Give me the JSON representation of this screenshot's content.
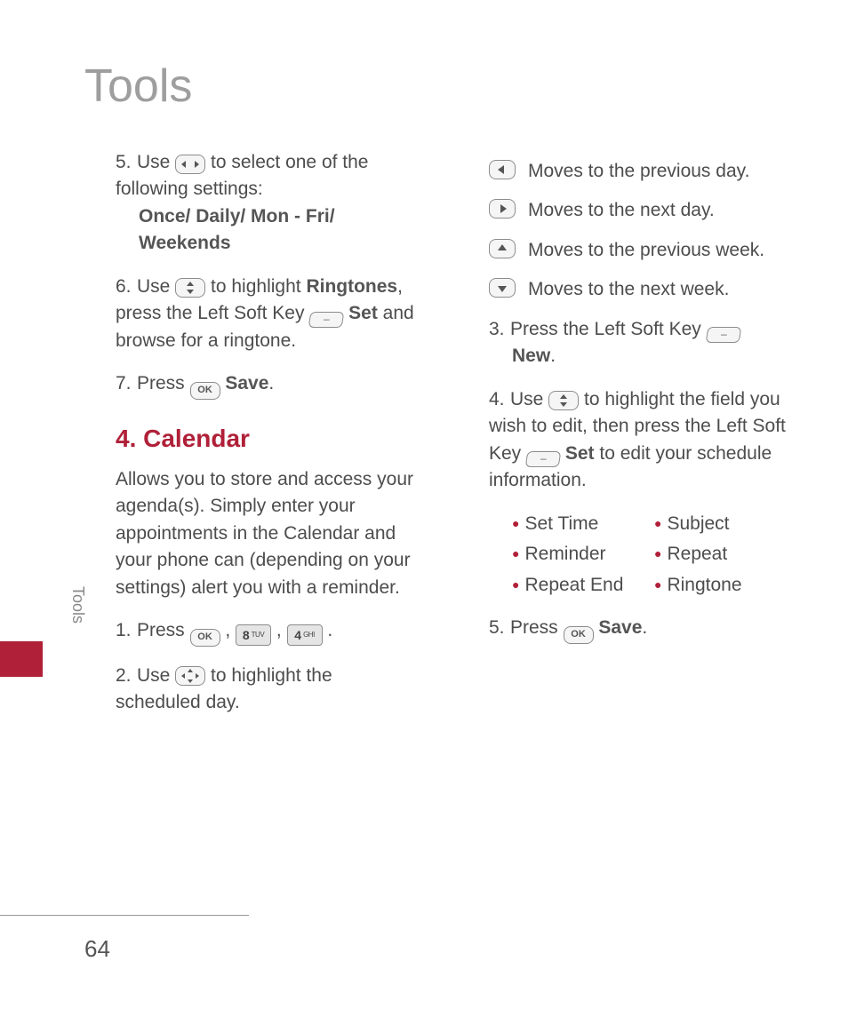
{
  "page_title": "Tools",
  "sidebar_label": "Tools",
  "page_number": "64",
  "left": {
    "step5_a": "Use ",
    "step5_b": " to select one of the following settings:",
    "step5_bold": "Once/ Daily/ Mon - Fri/ Weekends",
    "step6_a": "Use ",
    "step6_b": " to highlight ",
    "step6_bold1": "Ringtones",
    "step6_c": ", press the Left Soft Key ",
    "step6_bold2": "Set",
    "step6_d": " and browse for a ringtone.",
    "step7_a": "Press ",
    "step7_bold": "Save",
    "step7_b": ".",
    "heading": "4. Calendar",
    "intro": "Allows you to store and access your agenda(s). Simply enter your appointments in the Calendar and your phone can (depending on your settings) alert you with a reminder.",
    "cal1_a": "Press ",
    "cal1_sep": " ,  ",
    "cal1_end": " .",
    "cal2_a": "Use ",
    "cal2_b": " to highlight the scheduled day."
  },
  "right": {
    "nav_prev_day": "Moves to the previous day.",
    "nav_next_day": "Moves to the next day.",
    "nav_prev_week": "Moves to the previous week.",
    "nav_next_week": "Moves to the next week.",
    "step3_a": "Press the Left Soft Key ",
    "step3_bold": "New",
    "step3_b": ".",
    "step4_a": "Use ",
    "step4_b": " to highlight the field you wish to edit, then press the Left Soft Key ",
    "step4_bold": "Set",
    "step4_c": " to edit your schedule information.",
    "bullets": [
      "Set Time",
      "Subject",
      "Reminder",
      "Repeat",
      "Repeat End",
      "Ringtone"
    ],
    "step5_a": "Press ",
    "step5_bold": "Save",
    "step5_b": "."
  }
}
